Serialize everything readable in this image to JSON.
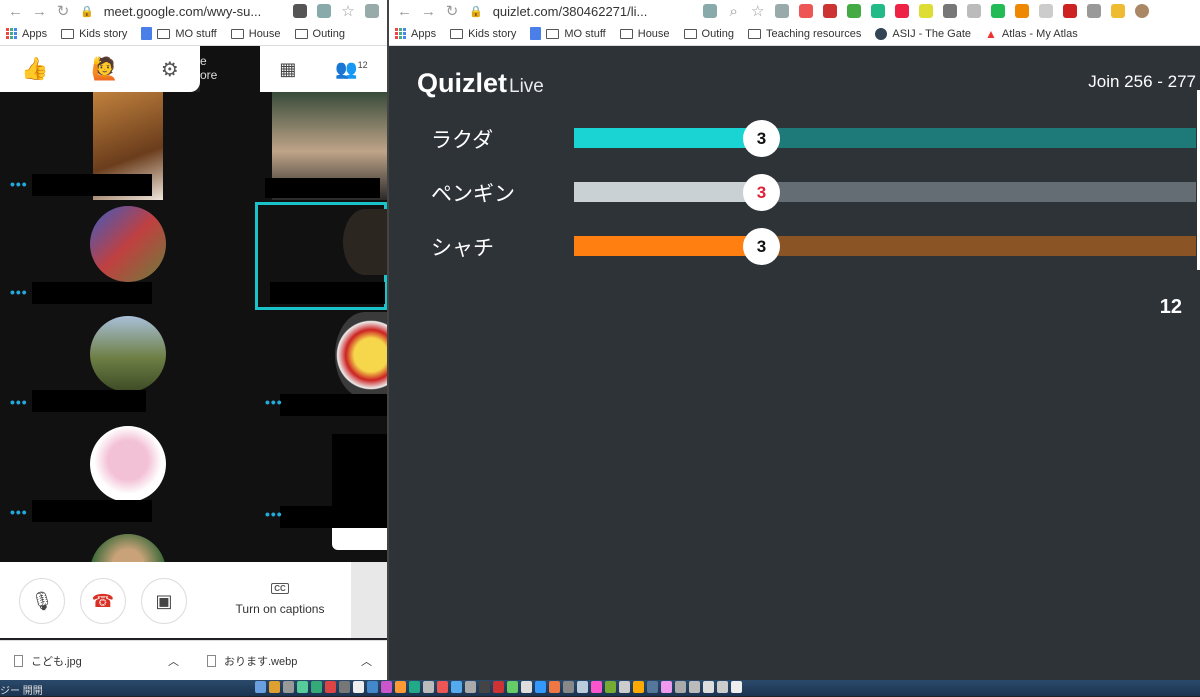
{
  "left_browser": {
    "url": "meet.google.com/wwy-su...",
    "bookmarks": [
      "Apps",
      "Kids story",
      "MO stuff",
      "House",
      "Outing"
    ]
  },
  "right_browser": {
    "url": "quizlet.com/380462271/li...",
    "bookmarks": [
      "Apps",
      "Kids story",
      "MO stuff",
      "House",
      "Outing",
      "Teaching resources",
      "ASIJ - The Gate",
      "Atlas - My Atlas"
    ]
  },
  "meet": {
    "present_stub": "e\nore",
    "participants_count": "12",
    "captions_label": "Turn on captions",
    "downloads": [
      "こども.jpg",
      "おります.webp"
    ]
  },
  "quizlet": {
    "logo": "Quizlet",
    "logo_suffix": "Live",
    "join_text": "Join 256 - 277",
    "timer": "12",
    "teams": [
      {
        "name": "ラクダ",
        "score": "3",
        "fill_fraction": 0.3,
        "fill_color": "#1ad3d3",
        "track_color": "#1e7a78",
        "score_color": "#111111"
      },
      {
        "name": "ペンギン",
        "score": "3",
        "fill_fraction": 0.3,
        "fill_color": "#c9d1d5",
        "track_color": "#646d73",
        "score_color": "#e0233a"
      },
      {
        "name": "シャチ",
        "score": "3",
        "fill_fraction": 0.3,
        "fill_color": "#ff7f10",
        "track_color": "#8a5424",
        "score_color": "#111111"
      }
    ]
  },
  "dock_label": "ジー 開開"
}
